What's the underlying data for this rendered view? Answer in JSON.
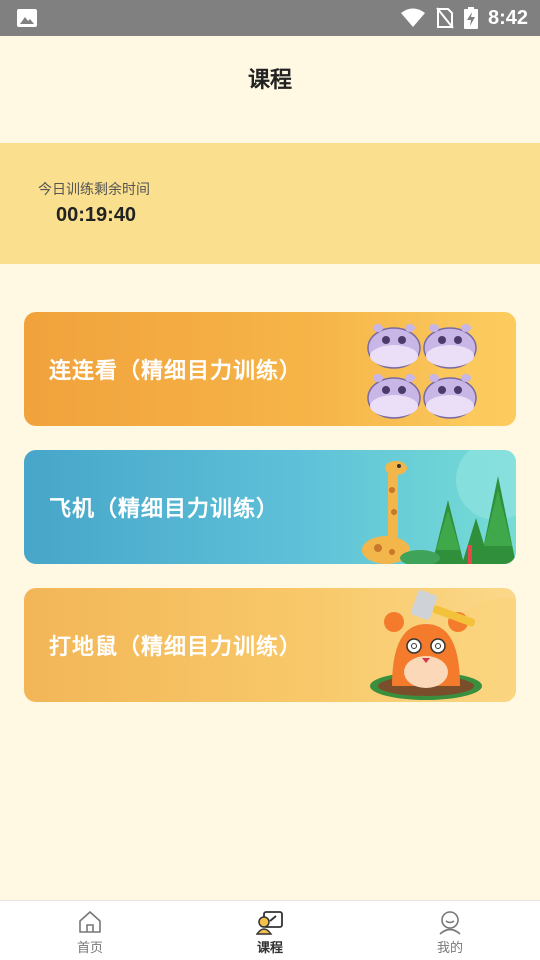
{
  "status_bar": {
    "time": "8:42",
    "icons": [
      "image-icon",
      "wifi-icon",
      "no-sim-icon",
      "battery-charging-icon"
    ]
  },
  "header": {
    "title": "课程"
  },
  "timer": {
    "label": "今日训练剩余时间",
    "value": "00:19:40"
  },
  "courses": [
    {
      "label": "连连看（精细目力训练）",
      "icon": "hippo-illustration",
      "color": "#f1a23c"
    },
    {
      "label": "飞机（精细目力训练）",
      "icon": "giraffe-forest-illustration",
      "color": "#47a6c9"
    },
    {
      "label": "打地鼠（精细目力训练）",
      "icon": "mole-hammer-illustration",
      "color": "#f2b657"
    }
  ],
  "bottom_nav": {
    "items": [
      {
        "label": "首页",
        "icon": "home-icon",
        "active": false
      },
      {
        "label": "课程",
        "icon": "course-icon",
        "active": true
      },
      {
        "label": "我的",
        "icon": "profile-icon",
        "active": false
      }
    ]
  }
}
